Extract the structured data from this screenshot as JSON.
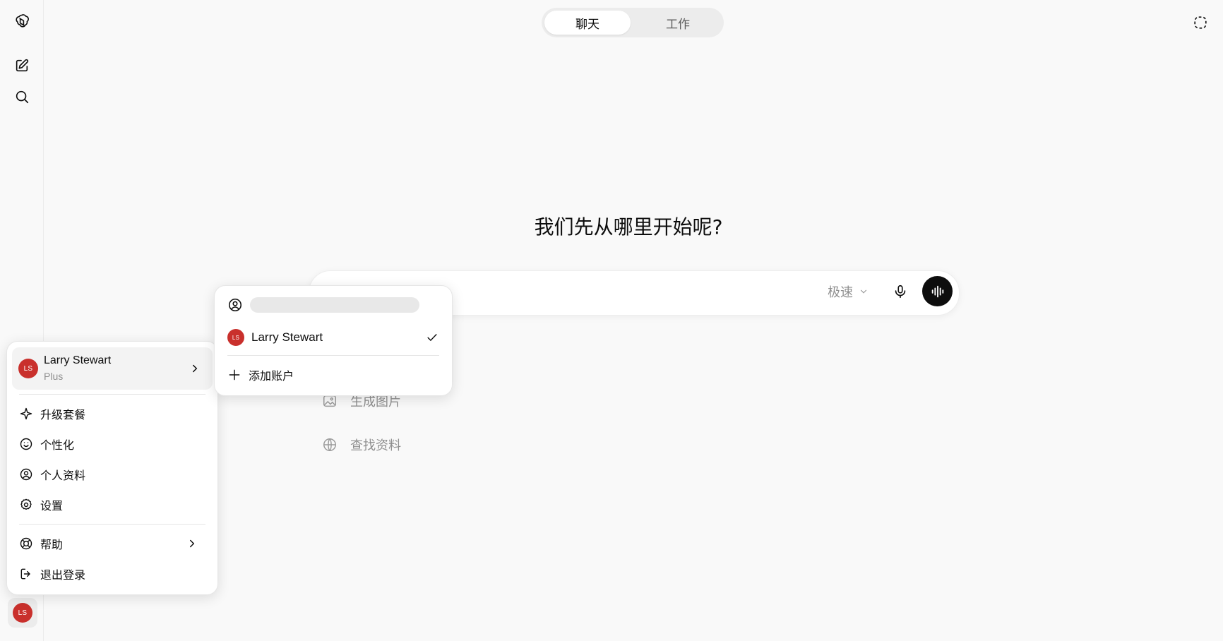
{
  "mode_toggle": {
    "tabs": [
      "聊天",
      "工作"
    ],
    "active": "聊天"
  },
  "main": {
    "headline": "我们先从哪里开始呢?",
    "model_select": "极速",
    "suggestions": [
      "生成图片",
      "查找资料"
    ]
  },
  "user": {
    "initials": "LS",
    "name": "Larry Stewart",
    "plan": "Plus"
  },
  "account_menu": {
    "items": [
      "升级套餐",
      "个性化",
      "个人资料",
      "设置"
    ],
    "help": "帮助",
    "logout": "退出登录"
  },
  "account_switcher": {
    "current": "Larry Stewart",
    "add_account": "添加账户"
  },
  "colors": {
    "avatar": "#c9302c",
    "background": "#f9f9f9"
  }
}
